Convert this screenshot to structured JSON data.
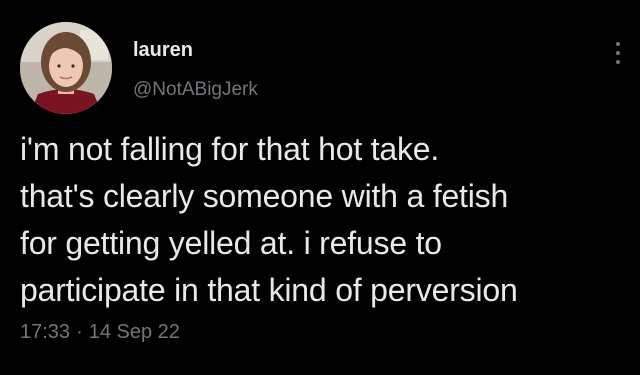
{
  "user": {
    "display_name": "lauren",
    "handle": "@NotABigJerk"
  },
  "icons": {
    "more": "more-options-icon",
    "avatar": "profile-photo"
  },
  "tweet": {
    "text": "i'm not falling for that hot take.\nthat's clearly someone with a fetish\nfor getting yelled at. i refuse to\nparticipate in that kind of perversion",
    "time": "17:33",
    "separator": "·",
    "date": "14 Sep 22"
  },
  "colors": {
    "background": "#000000",
    "primary_text": "#E7E9EA",
    "secondary_text": "#71767B"
  }
}
